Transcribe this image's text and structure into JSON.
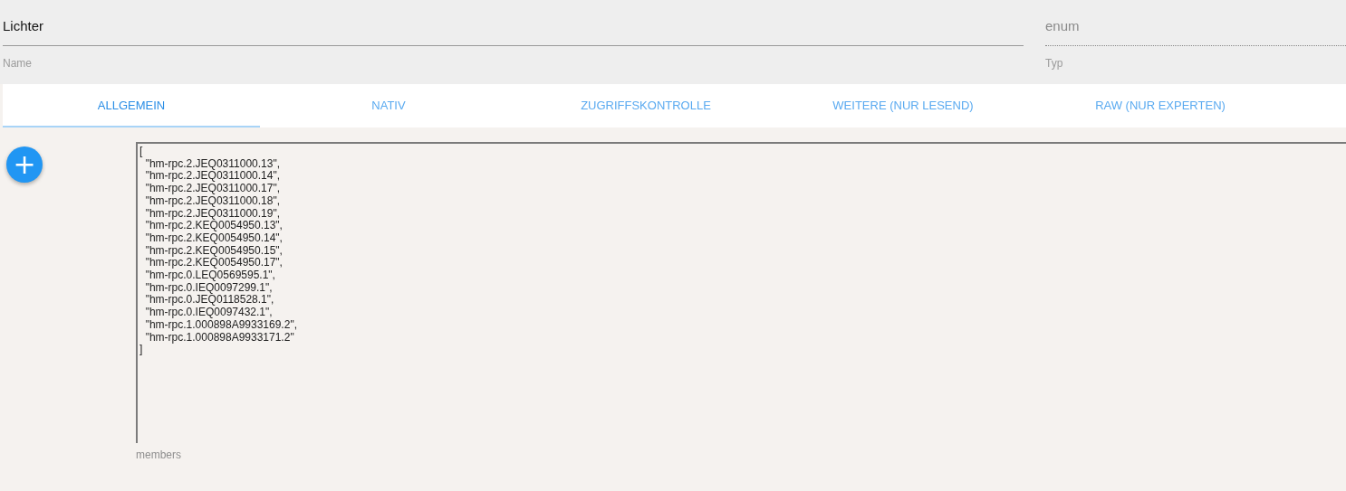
{
  "name_field": {
    "value": "Lichter",
    "label": "Name"
  },
  "type_field": {
    "value": "enum",
    "label": "Typ",
    "disabled": true
  },
  "tabs": [
    {
      "label": "ALLGEMEIN",
      "selected": true
    },
    {
      "label": "NATIV",
      "selected": false
    },
    {
      "label": "ZUGRIFFSKONTROLLE",
      "selected": false
    },
    {
      "label": "WEITERE (NUR LESEND)",
      "selected": false
    },
    {
      "label": "RAW (NUR EXPERTEN)",
      "selected": false
    }
  ],
  "add_button": {
    "label": "+"
  },
  "members_field": {
    "label": "members",
    "lines": [
      "[",
      "  \"hm-rpc.2.JEQ0311000.13\",",
      "  \"hm-rpc.2.JEQ0311000.14\",",
      "  \"hm-rpc.2.JEQ0311000.17\",",
      "  \"hm-rpc.2.JEQ0311000.18\",",
      "  \"hm-rpc.2.JEQ0311000.19\",",
      "  \"hm-rpc.2.KEQ0054950.13\",",
      "  \"hm-rpc.2.KEQ0054950.14\",",
      "  \"hm-rpc.2.KEQ0054950.15\",",
      "  \"hm-rpc.2.KEQ0054950.17\",",
      "  \"hm-rpc.0.LEQ0569595.1\",",
      "  \"hm-rpc.0.IEQ0097299.1\",",
      "  \"hm-rpc.0.JEQ0118528.1\",",
      "  \"hm-rpc.0.IEQ0097432.1\",",
      "  \"hm-rpc.1.000898A9933169.2\",",
      "  \"hm-rpc.1.000898A9933171.2\"",
      "]"
    ]
  }
}
